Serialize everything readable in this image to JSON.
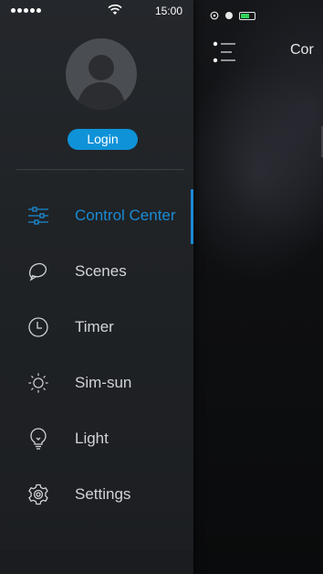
{
  "status": {
    "time": "15:00"
  },
  "main": {
    "title": "Cor"
  },
  "profile": {
    "login_label": "Login"
  },
  "nav": {
    "items": [
      {
        "label": "Control Center",
        "icon": "sliders-icon",
        "active": true
      },
      {
        "label": "Scenes",
        "icon": "scenes-icon",
        "active": false
      },
      {
        "label": "Timer",
        "icon": "clock-icon",
        "active": false
      },
      {
        "label": "Sim-sun",
        "icon": "sun-icon",
        "active": false
      },
      {
        "label": "Light",
        "icon": "bulb-icon",
        "active": false
      },
      {
        "label": "Settings",
        "icon": "gear-icon",
        "active": false
      }
    ]
  },
  "colors": {
    "accent": "#1a8ad4",
    "login_button": "#0f92d8",
    "drawer_bg": "#222528",
    "text": "#d2d4d7"
  }
}
